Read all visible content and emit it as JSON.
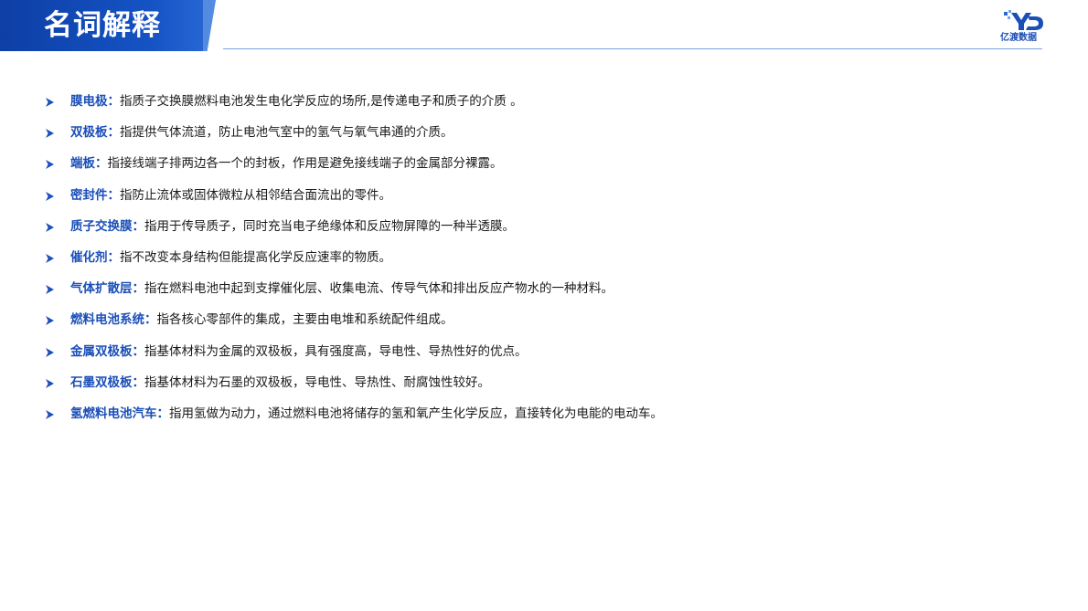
{
  "header": {
    "title": "名词解释"
  },
  "logo": {
    "text": "亿渡数据",
    "accent_color": "#1b4fb8"
  },
  "colors": {
    "header_band": "#1553c4",
    "term": "#1b4fb8",
    "body_text": "#1a1a1a",
    "rule": "#7aa2dc"
  },
  "bullet_icon": "arrowhead-bullet-icon",
  "separator": "：",
  "items": [
    {
      "term": "膜电极",
      "definition": "指质子交换膜燃料电池发生电化学反应的场所,是传递电子和质子的介质 。"
    },
    {
      "term": "双极板",
      "definition": "指提供气体流道，防止电池气室中的氢气与氧气串通的介质。"
    },
    {
      "term": "端板",
      "definition": "指接线端子排两边各一个的封板，作用是避免接线端子的金属部分裸露。"
    },
    {
      "term": "密封件",
      "definition": "指防止流体或固体微粒从相邻结合面流出的零件。"
    },
    {
      "term": "质子交换膜",
      "definition": "指用于传导质子，同时充当电子绝缘体和反应物屏障的一种半透膜。"
    },
    {
      "term": "催化剂",
      "definition": "指不改变本身结构但能提高化学反应速率的物质。"
    },
    {
      "term": "气体扩散层",
      "definition": "指在燃料电池中起到支撑催化层、收集电流、传导气体和排出反应产物水的一种材料。"
    },
    {
      "term": "燃料电池系统",
      "definition": "指各核心零部件的集成，主要由电堆和系统配件组成。"
    },
    {
      "term": "金属双极板",
      "definition": "指基体材料为金属的双极板，具有强度高，导电性、导热性好的优点。"
    },
    {
      "term": "石墨双极板",
      "definition": "指基体材料为石墨的双极板，导电性、导热性、耐腐蚀性较好。"
    },
    {
      "term": "氢燃料电池汽车",
      "definition": "指用氢做为动力，通过燃料电池将储存的氢和氧产生化学反应，直接转化为电能的电动车。"
    }
  ]
}
